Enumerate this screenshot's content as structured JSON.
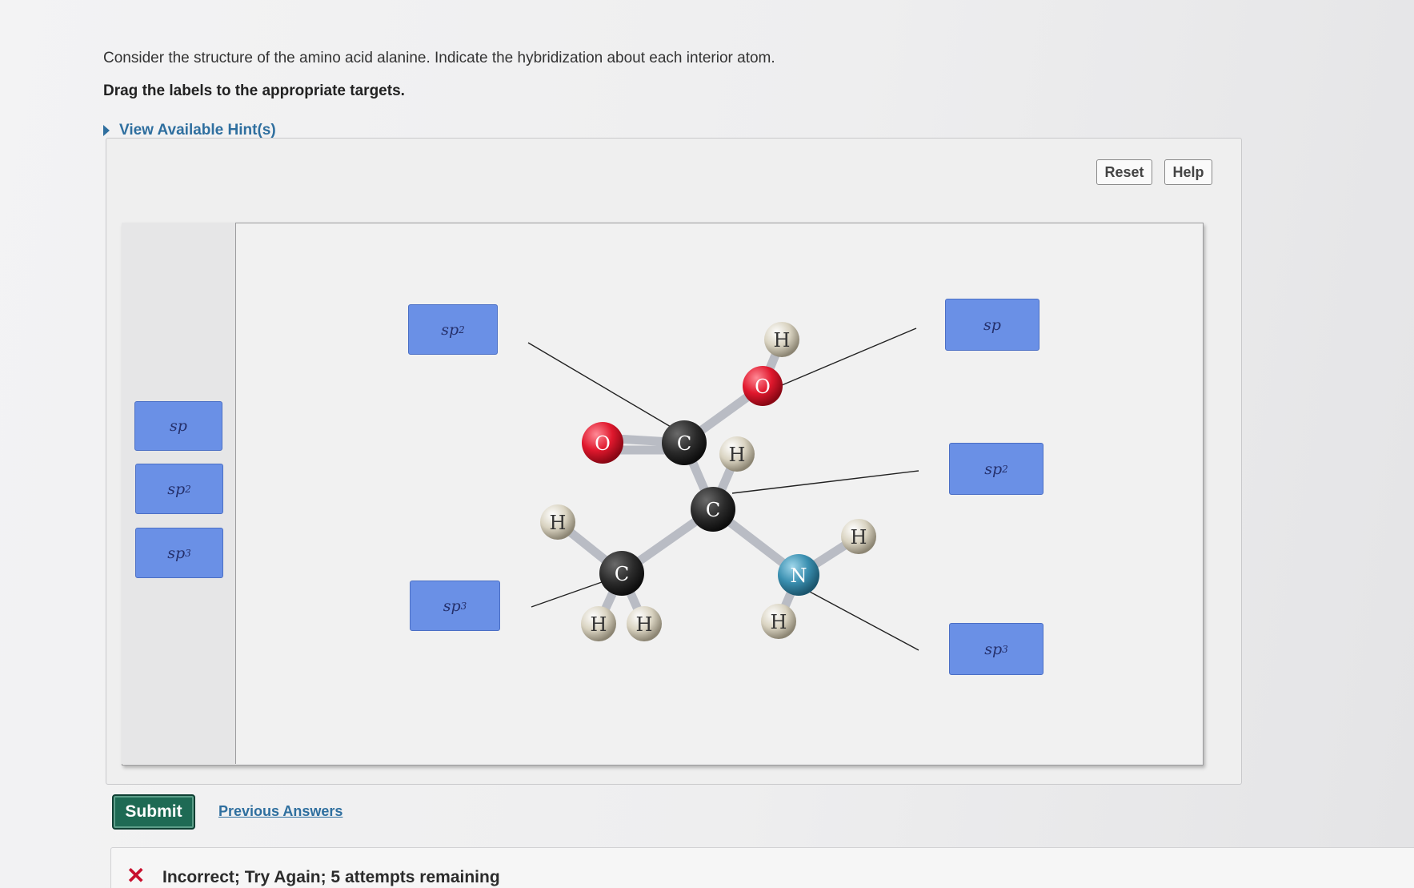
{
  "question": {
    "text": "Consider the structure of the amino acid alanine. Indicate the hybridization about each interior atom.",
    "instruction": "Drag the labels to the appropriate targets.",
    "hint_link": "View Available Hint(s)"
  },
  "toolbar": {
    "reset_label": "Reset",
    "help_label": "Help"
  },
  "label_bank": [
    {
      "base": "sp",
      "sup": ""
    },
    {
      "base": "sp",
      "sup": "2"
    },
    {
      "base": "sp",
      "sup": "3"
    }
  ],
  "placed_labels": [
    {
      "base": "sp",
      "sup": "2"
    },
    {
      "base": "sp",
      "sup": "3"
    },
    {
      "base": "sp",
      "sup": ""
    },
    {
      "base": "sp",
      "sup": "2"
    },
    {
      "base": "sp",
      "sup": "3"
    }
  ],
  "molecule": {
    "name": "alanine",
    "atoms": [
      "H",
      "O",
      "O",
      "C",
      "H",
      "C",
      "H",
      "H",
      "C",
      "N",
      "H",
      "H",
      "H"
    ],
    "colors": {
      "carbon": "#2a2a2a",
      "oxygen": "#e0182d",
      "nitrogen": "#3a8fb0",
      "hydrogen": "#cfc8b4",
      "bond": "#b9bcc4"
    }
  },
  "actions": {
    "submit_label": "Submit",
    "previous_answers_label": "Previous Answers"
  },
  "feedback": {
    "icon": "x-icon",
    "text": "Incorrect; Try Again; 5 attempts remaining"
  },
  "colors": {
    "label_bg": "#6a90e6",
    "link": "#2f6f9f",
    "submit_bg": "#1e6a54",
    "error": "#c8102e"
  }
}
